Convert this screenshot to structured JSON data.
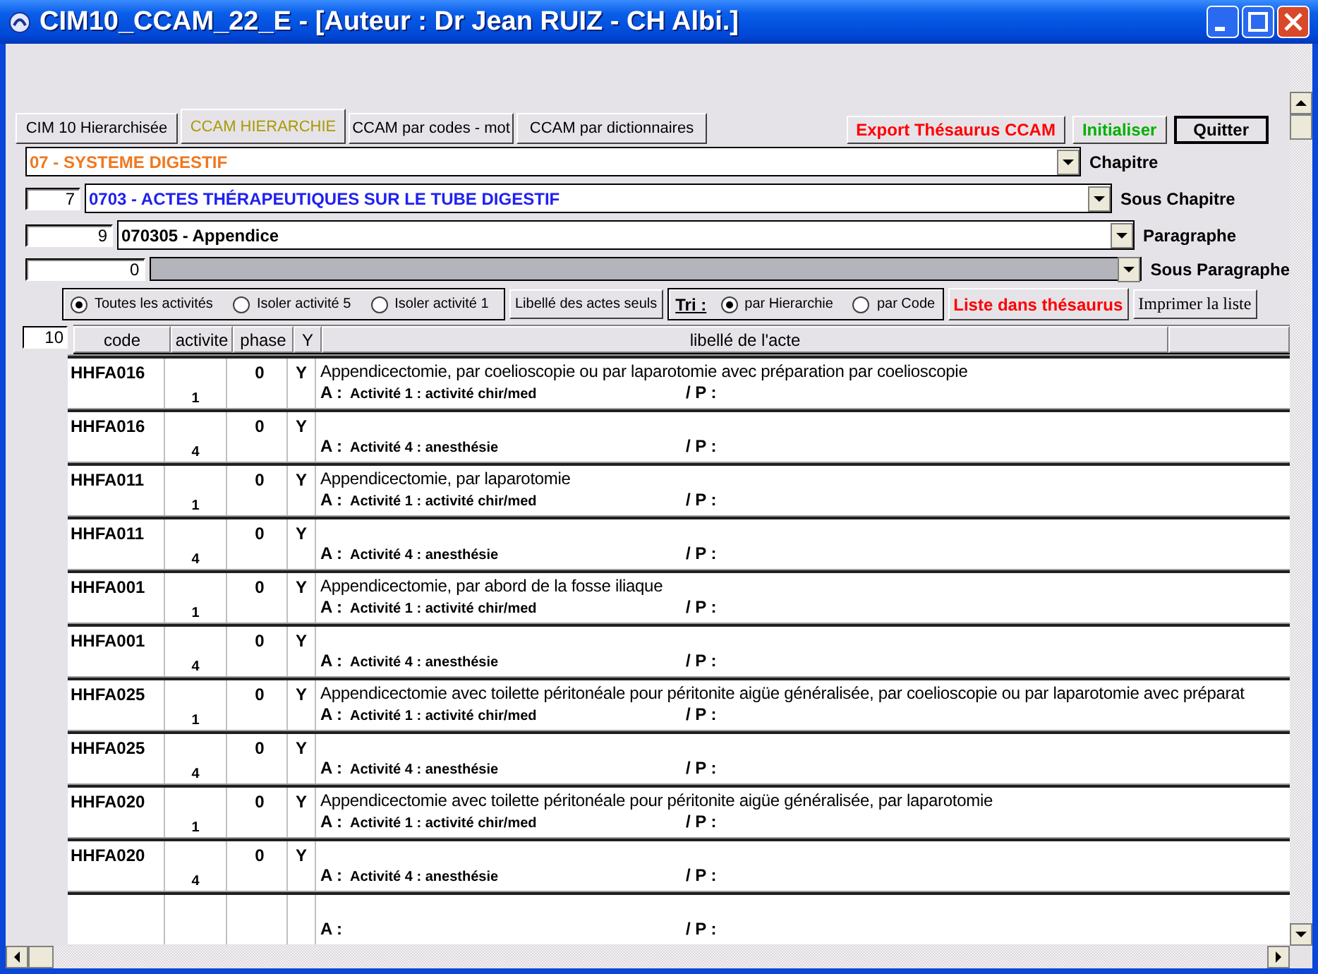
{
  "window": {
    "title": "CIM10_CCAM_22_E - [Auteur : Dr Jean RUIZ - CH Albi.]"
  },
  "tabs": [
    {
      "label": "CIM 10 Hierarchisée",
      "selected": false
    },
    {
      "label": "CCAM HIERARCHIE",
      "selected": true
    },
    {
      "label": "CCAM par codes - mot",
      "selected": false
    },
    {
      "label": "CCAM par dictionnaires",
      "selected": false
    }
  ],
  "actions": [
    {
      "label": "Export Thésaurus CCAM",
      "color": "#ff0000"
    },
    {
      "label": "Initialiser",
      "color": "#00b000"
    },
    {
      "label": "Quitter",
      "color": "#000000"
    }
  ],
  "selectors": [
    {
      "value": "07 - SYSTEME DIGESTIF",
      "color": "#f07820",
      "label": "Chapitre",
      "disabled": false
    },
    {
      "number": "7",
      "value": "0703 - ACTES THÉRAPEUTIQUES SUR LE TUBE DIGESTIF",
      "color": "#2020f0",
      "label": "Sous Chapitre",
      "disabled": false
    },
    {
      "number": "9",
      "value": "070305 - Appendice",
      "color": "#000000",
      "label": "Paragraphe",
      "disabled": false
    },
    {
      "number": "0",
      "label": "Sous Paragraphe",
      "disabled": true
    }
  ],
  "activity_filter": [
    {
      "label": "Toutes les activités",
      "selected": true
    },
    {
      "label": "Isoler activité 5",
      "selected": false
    },
    {
      "label": "Isoler activité 1",
      "selected": false
    }
  ],
  "libelle_button": "Libellé des actes seuls",
  "sort": {
    "label": "Tri :",
    "options": [
      {
        "label": "par Hierarchie",
        "selected": true
      },
      {
        "label": "par Code",
        "selected": false
      }
    ]
  },
  "list_button": "Liste dans thésaurus",
  "print_button": "Imprimer la liste",
  "table": {
    "count": "10",
    "columns": [
      "code",
      "activite",
      "phase",
      "Y",
      "libellé de l'acte"
    ],
    "rows": [
      {
        "code": "HHFA016",
        "activite": "1",
        "phase": "0",
        "y": "Y",
        "libelle": "Appendicectomie, par coelioscopie ou par laparotomie avec préparation par coelioscopie",
        "a": "A :",
        "activite_text": "Activité 1 : activité chir/med",
        "p": "/ P :"
      },
      {
        "code": "HHFA016",
        "activite": "4",
        "phase": "0",
        "y": "Y",
        "a": "A :",
        "activite_text": "Activité 4 : anesthésie",
        "p": "/ P :"
      },
      {
        "code": "HHFA011",
        "activite": "1",
        "phase": "0",
        "y": "Y",
        "libelle": "Appendicectomie, par laparotomie",
        "a": "A :",
        "activite_text": "Activité 1 : activité chir/med",
        "p": "/ P :"
      },
      {
        "code": "HHFA011",
        "activite": "4",
        "phase": "0",
        "y": "Y",
        "a": "A :",
        "activite_text": "Activité 4 : anesthésie",
        "p": "/ P :"
      },
      {
        "code": "HHFA001",
        "activite": "1",
        "phase": "0",
        "y": "Y",
        "libelle": "Appendicectomie, par abord de la fosse iliaque",
        "a": "A :",
        "activite_text": "Activité 1 : activité chir/med",
        "p": "/ P :"
      },
      {
        "code": "HHFA001",
        "activite": "4",
        "phase": "0",
        "y": "Y",
        "a": "A :",
        "activite_text": "Activité 4 : anesthésie",
        "p": "/ P :"
      },
      {
        "code": "HHFA025",
        "activite": "1",
        "phase": "0",
        "y": "Y",
        "libelle": "Appendicectomie avec toilette péritonéale pour péritonite aigüe généralisée, par coelioscopie ou par laparotomie avec préparat",
        "a": "A :",
        "activite_text": "Activité 1 : activité chir/med",
        "p": "/ P :"
      },
      {
        "code": "HHFA025",
        "activite": "4",
        "phase": "0",
        "y": "Y",
        "a": "A :",
        "activite_text": "Activité 4 : anesthésie",
        "p": "/ P :"
      },
      {
        "code": "HHFA020",
        "activite": "1",
        "phase": "0",
        "y": "Y",
        "libelle": "Appendicectomie avec toilette péritonéale pour péritonite aigüe généralisée, par laparotomie",
        "a": "A :",
        "activite_text": "Activité 1 : activité chir/med",
        "p": "/ P :"
      },
      {
        "code": "HHFA020",
        "activite": "4",
        "phase": "0",
        "y": "Y",
        "a": "A :",
        "activite_text": "Activité 4 : anesthésie",
        "p": "/ P :"
      },
      {
        "a": "A :",
        "p": "/ P :"
      }
    ]
  }
}
